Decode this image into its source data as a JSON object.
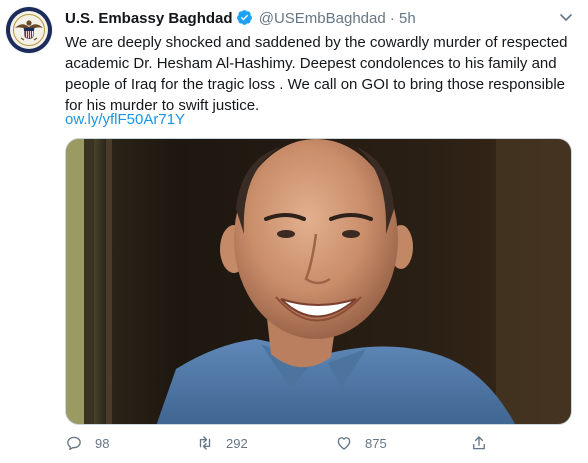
{
  "tweet": {
    "display_name": "U.S. Embassy Baghdad",
    "handle": "@USEmbBaghdad",
    "separator": "·",
    "time": "5h",
    "text": "We are deeply shocked and saddened by the cowardly murder of respected academic Dr. Hesham Al-Hashimy. Deepest condolences to his family and people of Iraq for the tragic loss . We call on GOI to bring those responsible for his murder to swift justice.",
    "link": "ow.ly/yflF50Ar71Y"
  },
  "actions": {
    "reply_count": "98",
    "retweet_count": "292",
    "like_count": "875"
  },
  "colors": {
    "link": "#1b95e0",
    "verified": "#1da1f2",
    "muted": "#657786",
    "text": "#14171a"
  },
  "icons": [
    "embassy-seal-icon",
    "verified-badge-icon",
    "chevron-down-icon",
    "reply-icon",
    "retweet-icon",
    "like-icon",
    "share-icon"
  ]
}
